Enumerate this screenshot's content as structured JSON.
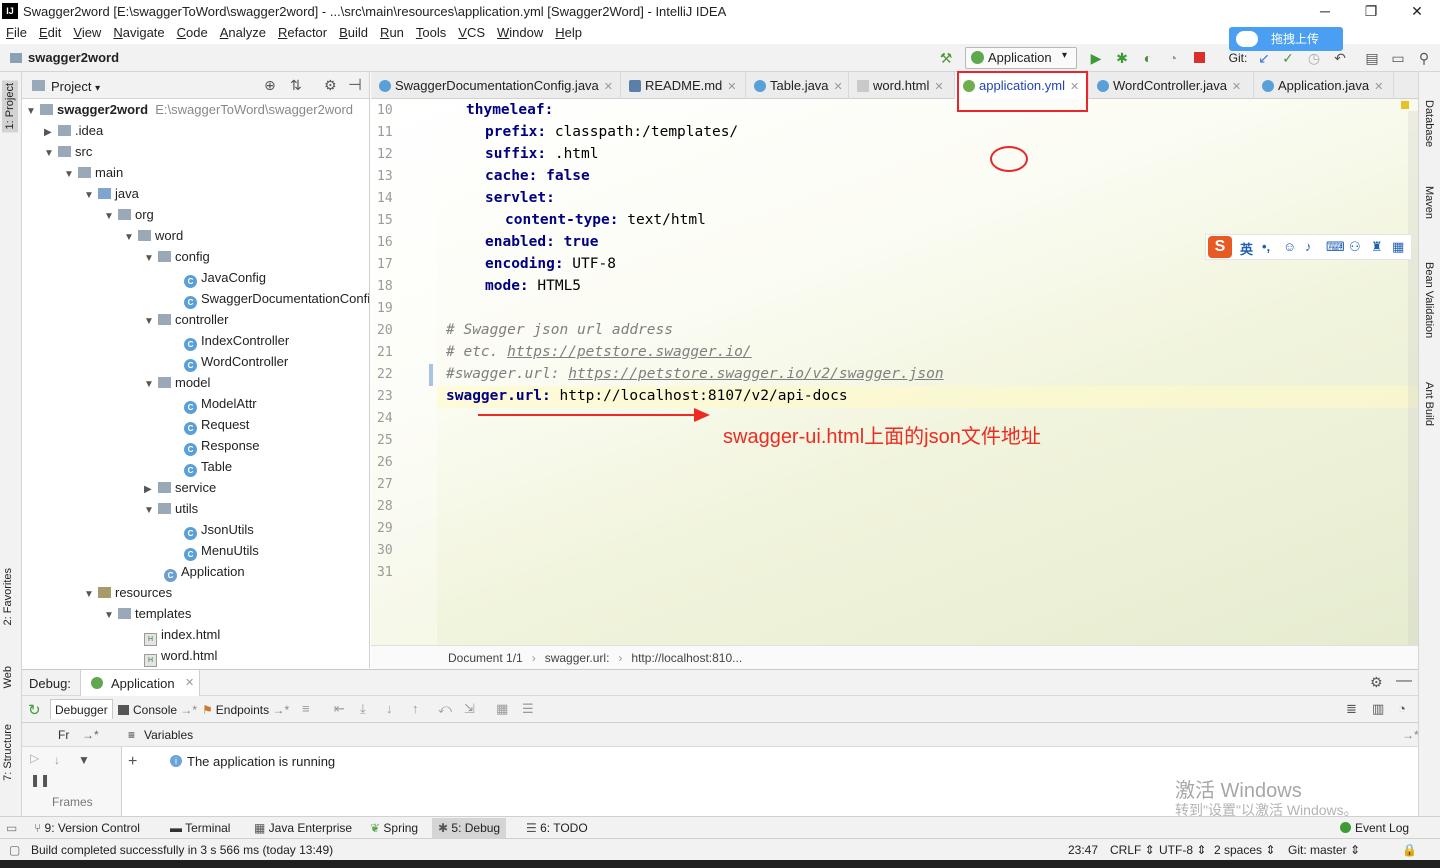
{
  "window": {
    "title": "Swagger2word [E:\\swaggerToWord\\swagger2word] - ...\\src\\main\\resources\\application.yml [Swagger2Word] - IntelliJ IDEA",
    "minimize": "─",
    "restore": "❐",
    "close": "✕"
  },
  "menu": [
    "File",
    "Edit",
    "View",
    "Navigate",
    "Code",
    "Analyze",
    "Refactor",
    "Build",
    "Run",
    "Tools",
    "VCS",
    "Window",
    "Help"
  ],
  "navbar": {
    "project": "swagger2word",
    "run_config": "Application",
    "git_label": "Git:",
    "upload_label": "拖拽上传"
  },
  "left_strip": {
    "project": "1: Project",
    "favorites": "2: Favorites",
    "web": "Web",
    "structure": "7: Structure"
  },
  "right_strip": {
    "database": "Database",
    "maven": "Maven",
    "bean": "Bean Validation",
    "ant": "Ant Build"
  },
  "project_panel": {
    "title": "Project",
    "tree": [
      {
        "label": "swagger2word",
        "extra": "E:\\swaggerToWord\\swagger2word",
        "type": "folder",
        "bold": true
      },
      {
        "label": ".idea",
        "type": "folder"
      },
      {
        "label": "src",
        "type": "folder"
      },
      {
        "label": "main",
        "type": "folder"
      },
      {
        "label": "java",
        "type": "folder"
      },
      {
        "label": "org",
        "type": "folder"
      },
      {
        "label": "word",
        "type": "folder"
      },
      {
        "label": "config",
        "type": "folder"
      },
      {
        "label": "JavaConfig",
        "type": "class"
      },
      {
        "label": "SwaggerDocumentationConfig",
        "type": "class"
      },
      {
        "label": "controller",
        "type": "folder"
      },
      {
        "label": "IndexController",
        "type": "class"
      },
      {
        "label": "WordController",
        "type": "class"
      },
      {
        "label": "model",
        "type": "folder"
      },
      {
        "label": "ModelAttr",
        "type": "class"
      },
      {
        "label": "Request",
        "type": "class"
      },
      {
        "label": "Response",
        "type": "class"
      },
      {
        "label": "Table",
        "type": "class"
      },
      {
        "label": "service",
        "type": "folder"
      },
      {
        "label": "utils",
        "type": "folder"
      },
      {
        "label": "JsonUtils",
        "type": "class"
      },
      {
        "label": "MenuUtils",
        "type": "class"
      },
      {
        "label": "Application",
        "type": "class"
      },
      {
        "label": "resources",
        "type": "folder"
      },
      {
        "label": "templates",
        "type": "folder"
      },
      {
        "label": "index.html",
        "type": "html"
      },
      {
        "label": "word.html",
        "type": "html"
      }
    ]
  },
  "editor_tabs": [
    {
      "label": "SwaggerDocumentationConfig.java"
    },
    {
      "label": "README.md"
    },
    {
      "label": "Table.java"
    },
    {
      "label": "word.html"
    },
    {
      "label": "application.yml",
      "active": true
    },
    {
      "label": "WordController.java"
    },
    {
      "label": "Application.java"
    }
  ],
  "code": {
    "lines": [
      "10",
      "11",
      "12",
      "13",
      "14",
      "15",
      "16",
      "17",
      "18",
      "19",
      "20",
      "21",
      "22",
      "23",
      "24",
      "25",
      "26",
      "27",
      "28",
      "29",
      "30",
      "31"
    ],
    "l10_key": "thymeleaf:",
    "l11_key": "prefix:",
    "l11_val": " classpath:/templates/",
    "l12_key": "suffix:",
    "l12_val": " .html",
    "l13_key": "cache:",
    "l13_val": " false",
    "l14_key": "servlet:",
    "l15_key": "content-type:",
    "l15_val": " text/html",
    "l16_key": "enabled:",
    "l16_val": " true",
    "l17_key": "encoding:",
    "l17_val": " UTF-8",
    "l18_key": "mode:",
    "l18_val": " HTML5",
    "l20": "# Swagger json url address",
    "l21_pre": "# etc. ",
    "l21_url": "https://petstore.swagger.io/",
    "l22_pre": "#swagger.url: ",
    "l22_url": "https://petstore.swagger.io/v2/swagger.json",
    "l23_key": "swagger.url:",
    "l23_val": " http://localhost:8107/v2/api-docs"
  },
  "annotation": "swagger-ui.html上面的json文件地址",
  "breadcrumb": [
    "Document 1/1",
    "swagger.url:",
    "http://localhost:810..."
  ],
  "ime": {
    "logo": "S",
    "lang": "英"
  },
  "debug": {
    "label": "Debug:",
    "config": "Application",
    "tabs": [
      "Debugger",
      "Console",
      "Endpoints"
    ],
    "frames_label": "Frames",
    "frames_tab": "Fr",
    "variables_label": "Variables",
    "message": "The application is running"
  },
  "toolwindows": [
    "9: Version Control",
    "Terminal",
    "Java Enterprise",
    "Spring",
    "5: Debug",
    "6: TODO"
  ],
  "event_log": "Event Log",
  "status": {
    "message": "Build completed successfully in 3 s 566 ms (today 13:49)",
    "position": "23:47",
    "line_sep": "CRLF",
    "encoding": "UTF-8",
    "indent": "2 spaces",
    "git": "Git: master"
  },
  "watermark": {
    "line1": "激活 Windows",
    "line2": "转到\"设置\"以激活 Windows。"
  }
}
